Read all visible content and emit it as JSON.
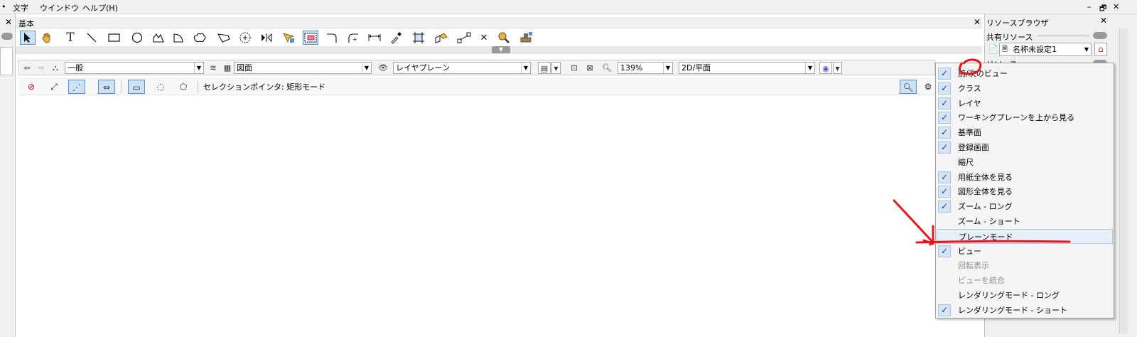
{
  "menubar": {
    "left_dot": "•",
    "items": [
      "文字",
      "ウインドウ",
      "ヘルプ(H)"
    ],
    "win_minimize": "–",
    "win_restore": "🗗",
    "win_close": "✕"
  },
  "left_strip": {
    "close": "✕"
  },
  "palette": {
    "title": "基本",
    "close": "✕",
    "text_tool_glyph": "T",
    "delete_tool_glyph": "✕"
  },
  "viewbar": {
    "class_value": "一般",
    "layer_value": "図面",
    "plane_value": "レイヤプレーン",
    "zoom_value": "139%",
    "view_value": "2D/平面"
  },
  "modebar": {
    "mode_label": "セレクションポインタ: 矩形モード"
  },
  "resource_browser": {
    "title": "リソースブラウザ",
    "close": "✕",
    "shared_label": "共有リソース",
    "file_value": "名称未設定1",
    "resource_label": "リソース"
  },
  "dropdown_menu": {
    "items": [
      {
        "label": "前/次のビュー",
        "checked": true,
        "disabled": false
      },
      {
        "label": "クラス",
        "checked": true,
        "disabled": false
      },
      {
        "label": "レイヤ",
        "checked": true,
        "disabled": false
      },
      {
        "label": "ワーキングプレーンを上から見る",
        "checked": true,
        "disabled": false
      },
      {
        "label": "基準面",
        "checked": true,
        "disabled": false
      },
      {
        "label": "登録画面",
        "checked": true,
        "disabled": false
      },
      {
        "label": "縮尺",
        "checked": false,
        "disabled": false
      },
      {
        "label": "用紙全体を見る",
        "checked": true,
        "disabled": false
      },
      {
        "label": "図形全体を見る",
        "checked": true,
        "disabled": false
      },
      {
        "label": "ズーム - ロング",
        "checked": true,
        "disabled": false
      },
      {
        "label": "ズーム - ショート",
        "checked": false,
        "disabled": false
      },
      {
        "label": "プレーンモード",
        "checked": false,
        "disabled": false,
        "highlighted": true
      },
      {
        "label": "ビュー",
        "checked": true,
        "disabled": false
      },
      {
        "label": "回転表示",
        "checked": false,
        "disabled": true
      },
      {
        "label": "ビューを統合",
        "checked": false,
        "disabled": true
      },
      {
        "label": "レンダリングモード - ロング",
        "checked": false,
        "disabled": false
      },
      {
        "label": "レンダリングモード - ショート",
        "checked": true,
        "disabled": false
      }
    ]
  },
  "colors": {
    "annotation_red": "#e8141c",
    "check_blue": "#1b3d82",
    "active_tool_bg": "#cde1f7"
  }
}
